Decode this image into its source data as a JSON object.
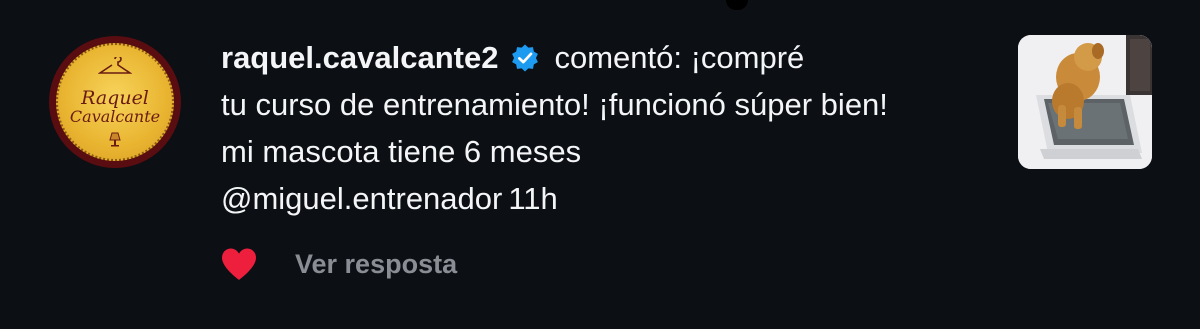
{
  "comment": {
    "username": "raquel.cavalcante2",
    "verified_icon": "verified-badge-icon",
    "action": "comentó:",
    "text_line1": "¡compré",
    "text_line2": "tu curso de entrenamiento! ¡funcionó súper bien!",
    "text_line3": "mi mascota tiene 6 meses",
    "mention": "@miguel.entrenador",
    "time": "11h"
  },
  "avatar": {
    "logo_text_line1": "Raquel",
    "logo_text_line2": "Cavalcante"
  },
  "footer": {
    "like_icon": "heart-icon",
    "reply_label": "Ver resposta"
  },
  "thumbnail": {
    "description_icon": "post-thumbnail-icon"
  },
  "colors": {
    "background": "#0c0f14",
    "text": "#f4f5f7",
    "verified_blue": "#1d9bf0",
    "heart_red": "#ed1f3c",
    "muted": "#8a8d93"
  }
}
